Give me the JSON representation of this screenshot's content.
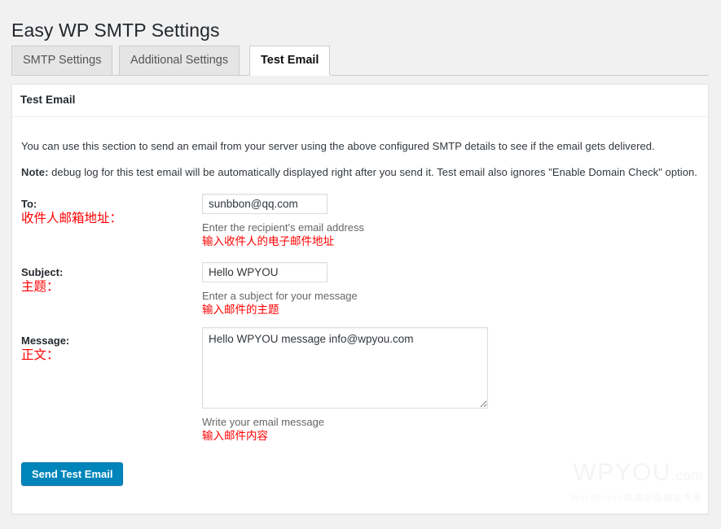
{
  "page": {
    "title": "Easy WP SMTP Settings"
  },
  "tabs": [
    {
      "label": "SMTP Settings",
      "active": false
    },
    {
      "label": "Additional Settings",
      "active": false
    },
    {
      "label": "Test Email",
      "active": true
    }
  ],
  "panel": {
    "header": "Test Email",
    "intro_line_1": "You can use this section to send an email from your server using the above configured SMTP details to see if the email gets delivered.",
    "intro_note_prefix": "Note:",
    "intro_note_rest": " debug log for this test email will be automatically displayed right after you send it. Test email also ignores \"Enable Domain Check\" option."
  },
  "form": {
    "to": {
      "label_en": "To:",
      "label_cn": "收件人邮箱地址：",
      "value": "sunbbon@qq.com",
      "placeholder": "",
      "help_en": "Enter the recipient's email address",
      "help_cn": "输入收件人的电子邮件地址"
    },
    "subject": {
      "label_en": "Subject:",
      "label_cn": "主题：",
      "value": "Hello WPYOU",
      "placeholder": "",
      "help_en": "Enter a subject for your message",
      "help_cn": "输入邮件的主题"
    },
    "message": {
      "label_en": "Message:",
      "label_cn": "正文：",
      "value": "Hello WPYOU message info@wpyou.com",
      "placeholder": "",
      "help_en": "Write your email message",
      "help_cn": "输入邮件内容"
    },
    "submit_label": "Send Test Email"
  },
  "watermark": {
    "brand": "WPYOU",
    "domain": ".com",
    "tagline": "WordPress高端企业建站专家"
  },
  "colors": {
    "accent_button": "#0085ba",
    "accent_button_border": "#0073aa",
    "annotation_red": "#ff0000",
    "page_background": "#f1f1f1",
    "panel_background": "#ffffff",
    "tab_inactive_background": "#e5e5e5"
  }
}
